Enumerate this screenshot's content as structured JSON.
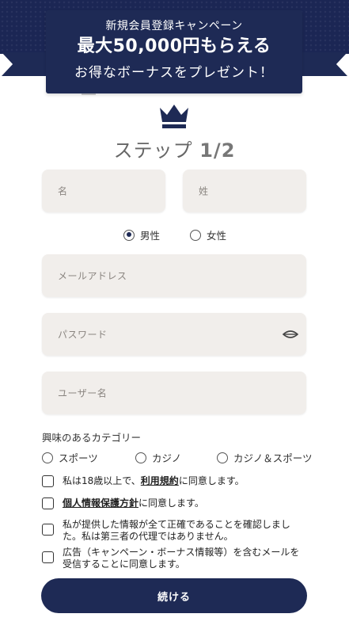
{
  "banner": {
    "line1": "新規会員登録キャンペーン",
    "line2": "最大50,000円もらえる",
    "line3": "お得なボーナスをプレゼント！"
  },
  "step": {
    "label": "ステップ",
    "value": "1/2"
  },
  "form": {
    "first_name_placeholder": "名",
    "last_name_placeholder": "姓",
    "gender": {
      "male": "男性",
      "female": "女性",
      "selected": "男性"
    },
    "email_placeholder": "メールアドレス",
    "password_placeholder": "パスワード",
    "username_placeholder": "ユーザー名"
  },
  "interests": {
    "label": "興味のあるカテゴリー",
    "options": [
      "スポーツ",
      "カジノ",
      "カジノ＆スポーツ"
    ]
  },
  "consents": {
    "age_prefix": "私は18歳以上で、",
    "age_link": "利用規約",
    "age_suffix": "に同意します。",
    "privacy_link": "個人情報保護方針",
    "privacy_suffix": "に同意します。",
    "accuracy": "私が提供した情報が全て正確であることを確認しました。私は第三者の代理ではありません。",
    "marketing": "広告（キャンペーン・ボーナス情報等）を含むメールを受信することに同意します。"
  },
  "submit_label": "続ける",
  "colors": {
    "navy": "#1e2a55",
    "field_bg": "#f1eeeb"
  }
}
